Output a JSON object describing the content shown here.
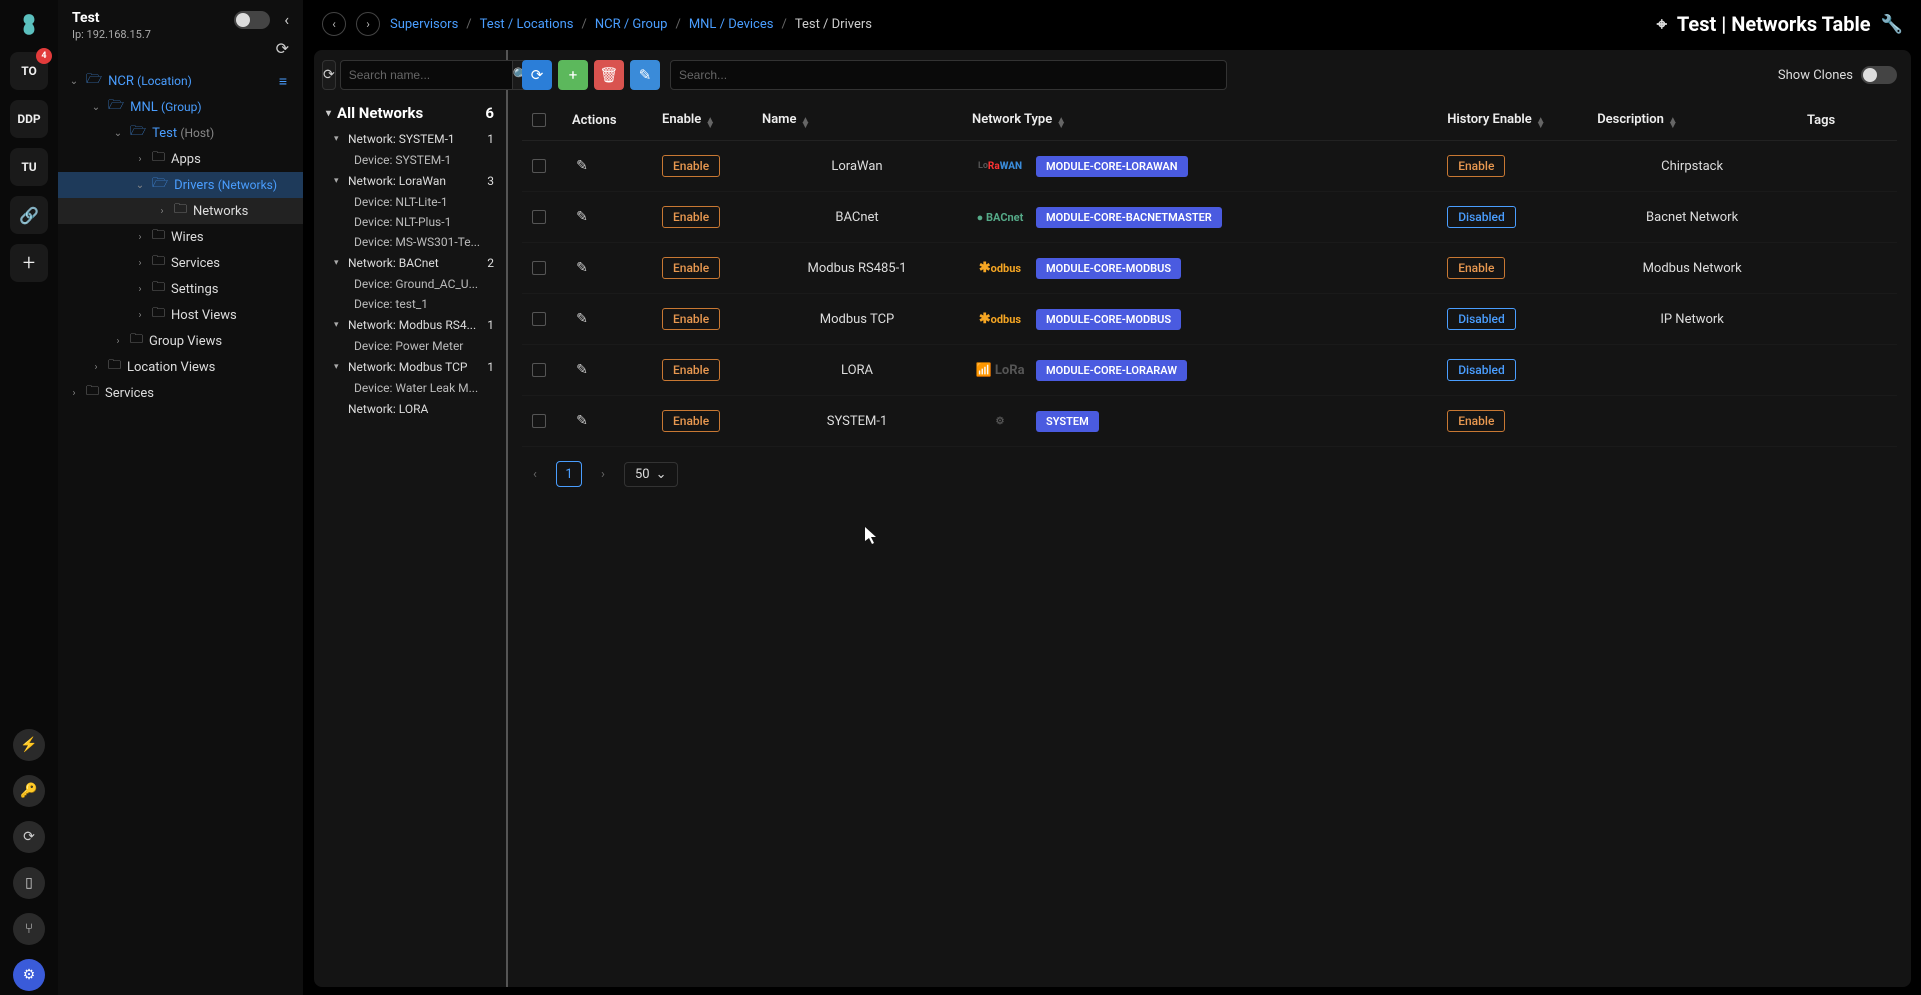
{
  "header": {
    "name": "Test",
    "ip_label": "Ip: 192.168.15.7"
  },
  "rail": {
    "badge_count": "4",
    "items": [
      "TO",
      "DDP",
      "TU"
    ],
    "link_icon": "🔗",
    "add_icon": "+"
  },
  "tree": {
    "ncr": {
      "label": "NCR",
      "anno": "(Location)"
    },
    "mnl": {
      "label": "MNL",
      "anno": "(Group)"
    },
    "test": {
      "label": "Test",
      "anno": "(Host)"
    },
    "apps": "Apps",
    "drivers": {
      "label": "Drivers",
      "anno": "(Networks)"
    },
    "networks": "Networks",
    "wires": "Wires",
    "services": "Services",
    "settings": "Settings",
    "host_views": "Host Views",
    "group_views": "Group Views",
    "location_views": "Location Views",
    "root_services": "Services"
  },
  "breadcrumbs": [
    {
      "label": "Supervisors",
      "current": false
    },
    {
      "label": "Test / Locations",
      "current": false
    },
    {
      "label": "NCR / Group",
      "current": false
    },
    {
      "label": "MNL / Devices",
      "current": false
    },
    {
      "label": "Test / Drivers",
      "current": true
    }
  ],
  "page_title": "Test | Networks Table",
  "left_pane": {
    "search_placeholder": "Search name...",
    "header": "All Networks",
    "count": "6",
    "networks": [
      {
        "name": "Network: SYSTEM-1",
        "count": "1",
        "devices": [
          "Device: SYSTEM-1"
        ]
      },
      {
        "name": "Network: LoraWan",
        "count": "3",
        "devices": [
          "Device: NLT-Lite-1",
          "Device: NLT-Plus-1",
          "Device: MS-WS301-Te..."
        ]
      },
      {
        "name": "Network: BACnet",
        "count": "2",
        "devices": [
          "Device: Ground_AC_U...",
          "Device: test_1"
        ]
      },
      {
        "name": "Network: Modbus RS4...",
        "count": "1",
        "devices": [
          "Device: Power Meter"
        ]
      },
      {
        "name": "Network: Modbus TCP",
        "count": "1",
        "devices": [
          "Device: Water Leak M..."
        ]
      },
      {
        "name": "Network: LORA",
        "count": "",
        "devices": []
      }
    ]
  },
  "toolbar": {
    "search_placeholder": "Search...",
    "show_clones_label": "Show Clones"
  },
  "table": {
    "columns": [
      "",
      "Actions",
      "Enable",
      "Name",
      "Network Type",
      "History Enable",
      "Description",
      "Tags"
    ],
    "rows": [
      {
        "name": "LoraWan",
        "enable": "Enable",
        "logo": "WAN",
        "module": "MODULE-CORE-LORAWAN",
        "history": "Enable",
        "desc": "Chirpstack"
      },
      {
        "name": "BACnet",
        "enable": "Enable",
        "logo": "BACnet",
        "module": "MODULE-CORE-BACNETMASTER",
        "history": "Disabled",
        "desc": "Bacnet Network"
      },
      {
        "name": "Modbus RS485-1",
        "enable": "Enable",
        "logo": "Modbus",
        "module": "MODULE-CORE-MODBUS",
        "history": "Enable",
        "desc": "Modbus Network"
      },
      {
        "name": "Modbus TCP",
        "enable": "Enable",
        "logo": "Modbus",
        "module": "MODULE-CORE-MODBUS",
        "history": "Disabled",
        "desc": "IP Network"
      },
      {
        "name": "LORA",
        "enable": "Enable",
        "logo": "LoRa",
        "module": "MODULE-CORE-LORARAW",
        "history": "Disabled",
        "desc": ""
      },
      {
        "name": "SYSTEM-1",
        "enable": "Enable",
        "logo": "sys",
        "module": "SYSTEM",
        "history": "Enable",
        "desc": ""
      }
    ]
  },
  "pager": {
    "page": "1",
    "size": "50"
  }
}
